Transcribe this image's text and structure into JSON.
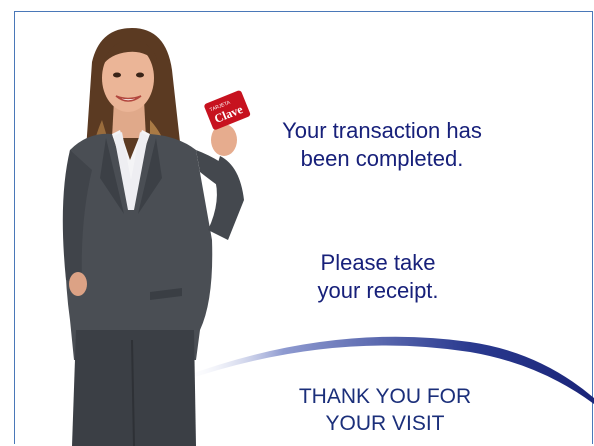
{
  "card": {
    "brand_small": "TARJETA",
    "brand": "Clave"
  },
  "messages": {
    "transaction_line1": "Your transaction has",
    "transaction_line2": "been completed.",
    "receipt_line1": "Please take",
    "receipt_line2": "your receipt.",
    "thanks_line1": "THANK YOU FOR",
    "thanks_line2": "YOUR VISIT"
  },
  "colors": {
    "text": "#17207a",
    "frame": "#4a78b8",
    "swoosh": "#1f2d86",
    "card": "#c7121f"
  }
}
